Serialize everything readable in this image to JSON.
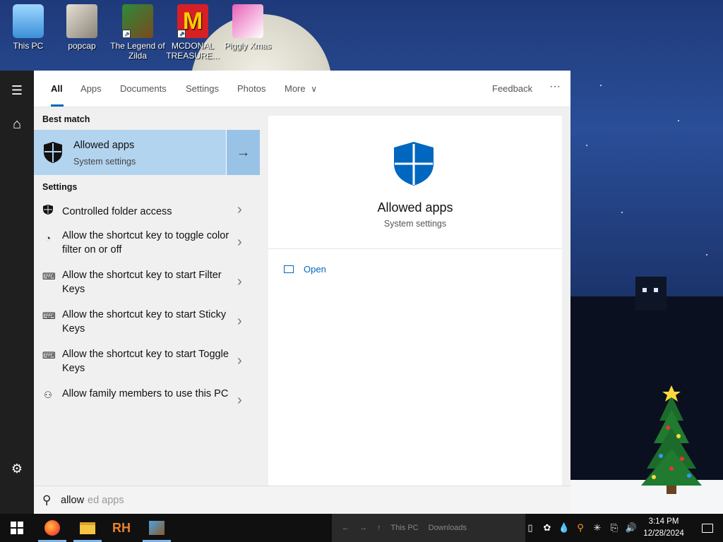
{
  "desktop": {
    "icons": [
      {
        "label": "This PC",
        "icon": "this-pc-icon"
      },
      {
        "label": "popcap",
        "icon": "popcap-icon"
      },
      {
        "label": "The Legend of Zilda",
        "icon": "zelda-game-icon"
      },
      {
        "label": "MCDONAL TREASURE...",
        "icon": "mcdonalds-game-icon"
      },
      {
        "label": "Piggly Xmas",
        "icon": "piggly-xmas-icon"
      }
    ]
  },
  "rail": {
    "hamburger": "☰",
    "home": "⌂",
    "settings": "⚙"
  },
  "tabs": [
    {
      "label": "All",
      "active": true
    },
    {
      "label": "Apps"
    },
    {
      "label": "Documents"
    },
    {
      "label": "Settings"
    },
    {
      "label": "Photos"
    },
    {
      "label": "More"
    }
  ],
  "tab_more_chevron": "∨",
  "feedback": "Feedback",
  "overflow": "···",
  "results": {
    "best_match_header": "Best match",
    "best_match": {
      "title": "Allowed apps",
      "subtitle": "System settings",
      "icon": "shield-icon",
      "arrow": "→"
    },
    "settings_header": "Settings",
    "items": [
      {
        "text": "Controlled folder access",
        "icon": "shield-icon"
      },
      {
        "text": "Allow the shortcut key to toggle color filter on or off",
        "icon": "palette-icon"
      },
      {
        "text": "Allow the shortcut key to start Filter Keys",
        "icon": "keyboard-icon"
      },
      {
        "text": "Allow the shortcut key to start Sticky Keys",
        "icon": "keyboard-icon"
      },
      {
        "text": "Allow the shortcut key to start Toggle Keys",
        "icon": "keyboard-icon"
      },
      {
        "text": "Allow family members to use this PC",
        "icon": "add-person-icon"
      }
    ],
    "chevron": "›"
  },
  "detail": {
    "title": "Allowed apps",
    "subtitle": "System settings",
    "open_label": "Open",
    "accent": "#0067c0"
  },
  "search": {
    "icon": "⚲",
    "typed": "allow",
    "ghost": "ed apps"
  },
  "taskbar": {
    "start_icon": "windows-logo-icon",
    "pinned": [
      "firefox-icon",
      "file-explorer-icon",
      "rh-app-icon",
      "app-icon"
    ],
    "rh_label": "RH",
    "explorer_fragments": [
      "←",
      "→",
      "↑",
      "This PC",
      "Downloads"
    ],
    "time": "3:14 PM",
    "date": "12/28/2024",
    "notification_icon": "notification-icon"
  }
}
